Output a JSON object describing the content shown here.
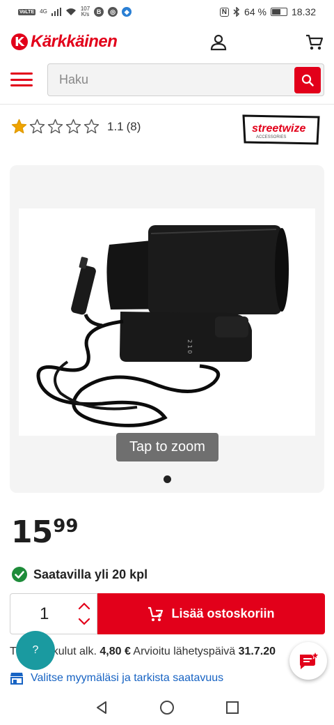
{
  "statusbar": {
    "net_chip": "VoLTE",
    "net_gen": "4G",
    "speed": "107",
    "speed_unit": "K/s",
    "nfc": "N",
    "battery": "64 %",
    "battery_level": 0.64,
    "time": "18.32"
  },
  "header": {
    "logo_text": "Kärkkäinen",
    "search_placeholder": "Haku"
  },
  "product": {
    "rating_value": 1,
    "rating_max": 5,
    "rating_score": "1.1",
    "rating_count": "(8)",
    "brand_name": "streetwize",
    "brand_sub": "ACCESSORIES",
    "zoom_hint": "Tap to zoom",
    "price_int": "15",
    "price_dec": "99",
    "stock_text": "Saatavilla yli 20 kpl",
    "quantity": "1",
    "add_to_cart": "Lisää ostoskoriin",
    "shipping_prefix": "T",
    "shipping_mid": "kulut alk.",
    "shipping_price": "4,80 €",
    "shipping_date_label": "Arvioitu lähetyspäivä",
    "shipping_date": "31.7.20",
    "store_link": "Valitse myymäläsi ja tarkista saatavuus"
  },
  "widgets": {
    "help_label": "?"
  },
  "colors": {
    "brand_red": "#e2001a",
    "help_teal": "#1a9aa0",
    "link_blue": "#1763c3",
    "stock_green": "#1e8c3a"
  },
  "icons": [
    "user-icon",
    "cart-icon",
    "search-icon",
    "star-icon",
    "check-icon",
    "cart-plus-icon",
    "chat-icon",
    "store-icon",
    "back-icon",
    "home-icon",
    "recents-icon"
  ]
}
